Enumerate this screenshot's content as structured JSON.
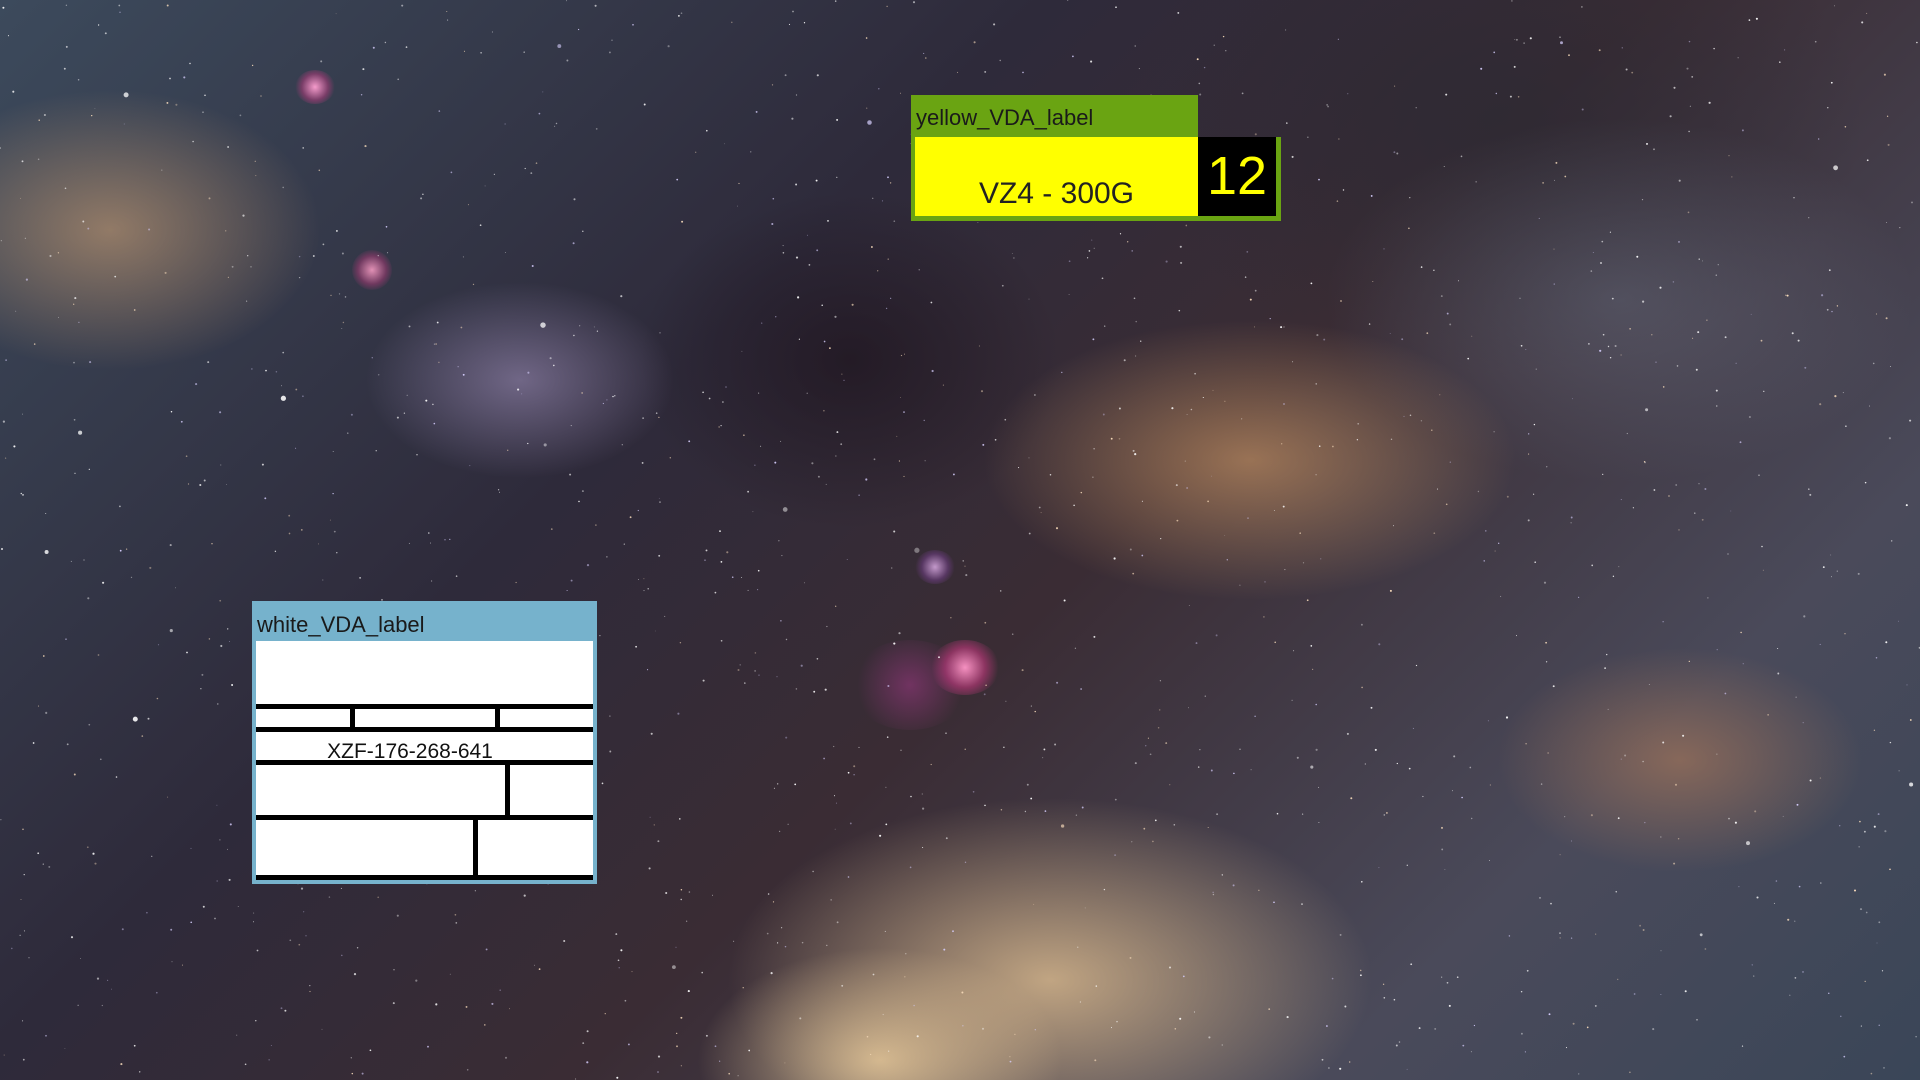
{
  "desktop": {
    "wallpaper": "milky-way-nebula"
  },
  "yellow_label": {
    "title": "yellow_VDA_label",
    "code": "VZ4 - 300G",
    "number": "12",
    "colors": {
      "titlebar": "#6aa412",
      "body": "#ffff00",
      "number_bg": "#000000",
      "number_fg": "#ffff00"
    }
  },
  "white_label": {
    "title": "white_VDA_label",
    "code": "XZF-176-268-641",
    "colors": {
      "frame": "#76b2cc",
      "body": "#ffffff",
      "rules": "#000000"
    }
  }
}
